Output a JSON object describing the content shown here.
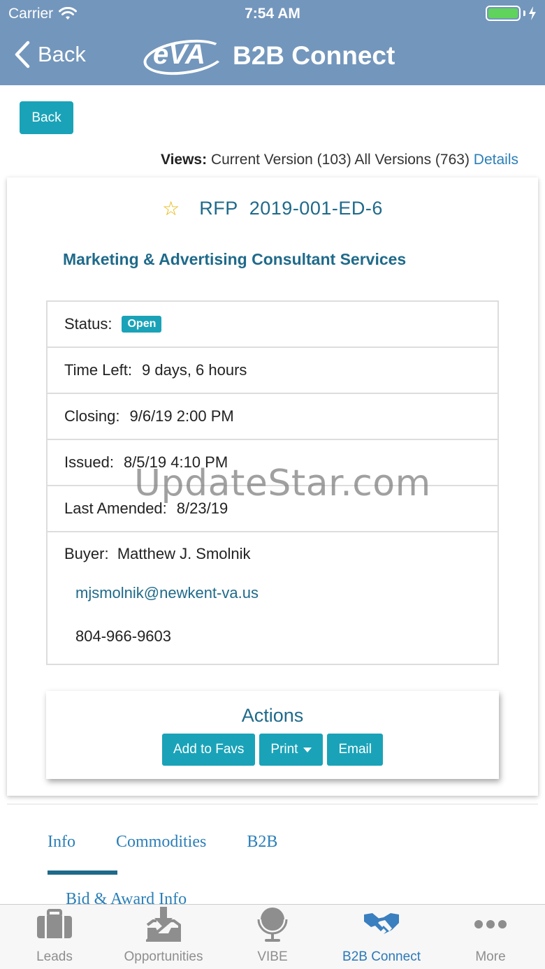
{
  "status_bar": {
    "carrier": "Carrier",
    "time": "7:54 AM"
  },
  "nav": {
    "back_label": "Back",
    "logo_text": "eVA",
    "app_name": "B2B Connect"
  },
  "page": {
    "back_button": "Back",
    "views_label": "Views:",
    "views_text": "Current Version (103) All Versions (763)",
    "details_link": "Details"
  },
  "solicitation": {
    "type": "RFP",
    "number": "2019-001-ED-6",
    "title": "Marketing & Advertising Consultant Services",
    "status_label": "Status:",
    "status_value": "Open",
    "time_left_label": "Time Left:",
    "time_left_value": "9 days, 6 hours",
    "closing_label": "Closing:",
    "closing_value": "9/6/19 2:00 PM",
    "issued_label": "Issued:",
    "issued_value": "8/5/19 4:10 PM",
    "amended_label": "Last Amended:",
    "amended_value": "8/23/19",
    "buyer_label": "Buyer:",
    "buyer_name": "Matthew J. Smolnik",
    "buyer_email": "mjsmolnik@newkent-va.us",
    "buyer_phone": "804-966-9603"
  },
  "actions": {
    "heading": "Actions",
    "add_favs": "Add to Favs",
    "print": "Print",
    "email": "Email"
  },
  "detail_tabs": {
    "items": [
      "Info",
      "Commodities",
      "B2B"
    ],
    "active": "Info",
    "section": "Bid & Award Info"
  },
  "watermark": "UpdateStar.com",
  "tabbar": {
    "items": [
      {
        "label": "Leads",
        "icon": "briefcase-icon"
      },
      {
        "label": "Opportunities",
        "icon": "inbox-download-icon"
      },
      {
        "label": "VIBE",
        "icon": "globe-icon"
      },
      {
        "label": "B2B Connect",
        "icon": "handshake-icon"
      },
      {
        "label": "More",
        "icon": "more-dots-icon"
      }
    ],
    "active": "B2B Connect"
  },
  "colors": {
    "nav_bg": "#7396bc",
    "accent": "#1aa3b8",
    "title": "#1f6a8a",
    "link": "#2b7fb8"
  }
}
